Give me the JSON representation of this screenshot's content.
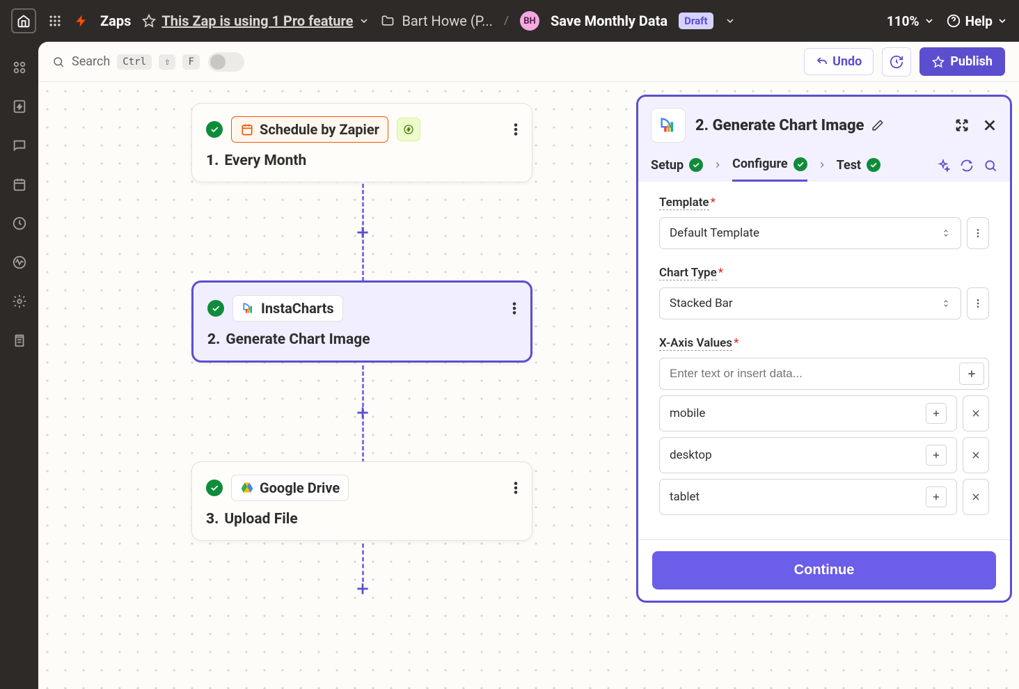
{
  "top": {
    "zaps": "Zaps",
    "pro_feature": "This Zap is using 1 Pro feature",
    "folder": "Bart Howe (P...",
    "avatar": "BH",
    "title": "Save Monthly Data",
    "draft": "Draft",
    "zoom": "110%",
    "help": "Help"
  },
  "toolbar": {
    "search": "Search",
    "kbd1": "Ctrl",
    "kbd2": "⇧",
    "kbd3": "F",
    "undo": "Undo",
    "publish": "Publish"
  },
  "steps": [
    {
      "app": "Schedule by Zapier",
      "num": "1.",
      "title": "Every Month"
    },
    {
      "app": "InstaCharts",
      "num": "2.",
      "title": "Generate Chart Image"
    },
    {
      "app": "Google Drive",
      "num": "3.",
      "title": "Upload File"
    }
  ],
  "panel": {
    "title": "2. Generate Chart Image",
    "tabs": {
      "setup": "Setup",
      "configure": "Configure",
      "test": "Test"
    },
    "fields": {
      "template_label": "Template",
      "template_value": "Default Template",
      "chart_type_label": "Chart Type",
      "chart_type_value": "Stacked Bar",
      "xaxis_label": "X-Axis Values",
      "xaxis_placeholder": "Enter text or insert data...",
      "xvalues": [
        "mobile",
        "desktop",
        "tablet"
      ]
    },
    "continue": "Continue"
  }
}
